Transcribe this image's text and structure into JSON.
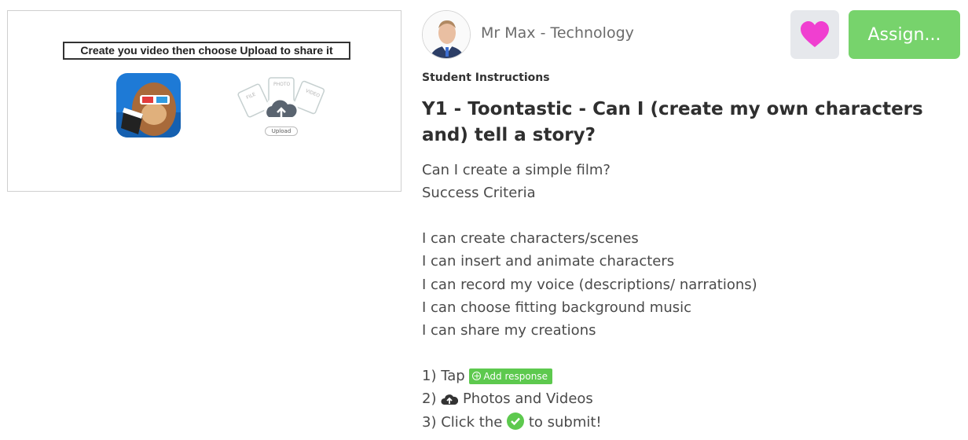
{
  "thumbnail": {
    "banner_text": "Create you video then choose Upload to share it",
    "upload_label": "Upload",
    "folder_labels": [
      "FILE",
      "PHOTO",
      "VIDEO"
    ]
  },
  "teacher": {
    "name": "Mr Max - Technology"
  },
  "actions": {
    "assign_label": "Assign...",
    "heart_icon": "heart-icon"
  },
  "instructions": {
    "label": "Student Instructions",
    "title": "Y1 - Toontastic - Can I (create my own characters and) tell a story?",
    "lines": [
      "Can I create a simple film?",
      "Success Criteria",
      "I can create characters/scenes",
      "I can insert and animate characters",
      "I can record my voice (descriptions/ narrations)",
      "I can choose fitting background music",
      "I can share my creations"
    ],
    "steps": {
      "step1_prefix": "1) Tap",
      "add_response_label": "Add response",
      "step2_prefix": "2)",
      "step2_text": "Photos and Videos",
      "step3_prefix": "3) Click the",
      "step3_suffix": "to submit!"
    }
  },
  "colors": {
    "accent_green": "#77d36c",
    "pill_green": "#5dc94e",
    "heart_pink": "#f03fd0"
  }
}
